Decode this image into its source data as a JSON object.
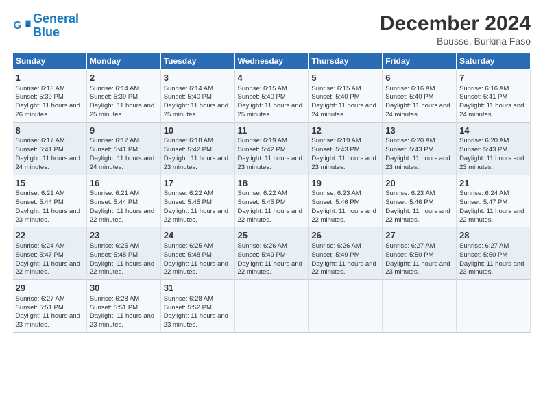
{
  "logo": {
    "line1": "General",
    "line2": "Blue"
  },
  "title": "December 2024",
  "subtitle": "Bousse, Burkina Faso",
  "days_of_week": [
    "Sunday",
    "Monday",
    "Tuesday",
    "Wednesday",
    "Thursday",
    "Friday",
    "Saturday"
  ],
  "weeks": [
    [
      {
        "day": "1",
        "sunrise": "6:13 AM",
        "sunset": "5:39 PM",
        "daylight": "11 hours and 26 minutes."
      },
      {
        "day": "2",
        "sunrise": "6:14 AM",
        "sunset": "5:39 PM",
        "daylight": "11 hours and 25 minutes."
      },
      {
        "day": "3",
        "sunrise": "6:14 AM",
        "sunset": "5:40 PM",
        "daylight": "11 hours and 25 minutes."
      },
      {
        "day": "4",
        "sunrise": "6:15 AM",
        "sunset": "5:40 PM",
        "daylight": "11 hours and 25 minutes."
      },
      {
        "day": "5",
        "sunrise": "6:15 AM",
        "sunset": "5:40 PM",
        "daylight": "11 hours and 24 minutes."
      },
      {
        "day": "6",
        "sunrise": "6:16 AM",
        "sunset": "5:40 PM",
        "daylight": "11 hours and 24 minutes."
      },
      {
        "day": "7",
        "sunrise": "6:16 AM",
        "sunset": "5:41 PM",
        "daylight": "11 hours and 24 minutes."
      }
    ],
    [
      {
        "day": "8",
        "sunrise": "6:17 AM",
        "sunset": "5:41 PM",
        "daylight": "11 hours and 24 minutes."
      },
      {
        "day": "9",
        "sunrise": "6:17 AM",
        "sunset": "5:41 PM",
        "daylight": "11 hours and 24 minutes."
      },
      {
        "day": "10",
        "sunrise": "6:18 AM",
        "sunset": "5:42 PM",
        "daylight": "11 hours and 23 minutes."
      },
      {
        "day": "11",
        "sunrise": "6:19 AM",
        "sunset": "5:42 PM",
        "daylight": "11 hours and 23 minutes."
      },
      {
        "day": "12",
        "sunrise": "6:19 AM",
        "sunset": "5:43 PM",
        "daylight": "11 hours and 23 minutes."
      },
      {
        "day": "13",
        "sunrise": "6:20 AM",
        "sunset": "5:43 PM",
        "daylight": "11 hours and 23 minutes."
      },
      {
        "day": "14",
        "sunrise": "6:20 AM",
        "sunset": "5:43 PM",
        "daylight": "11 hours and 23 minutes."
      }
    ],
    [
      {
        "day": "15",
        "sunrise": "6:21 AM",
        "sunset": "5:44 PM",
        "daylight": "11 hours and 23 minutes."
      },
      {
        "day": "16",
        "sunrise": "6:21 AM",
        "sunset": "5:44 PM",
        "daylight": "11 hours and 22 minutes."
      },
      {
        "day": "17",
        "sunrise": "6:22 AM",
        "sunset": "5:45 PM",
        "daylight": "11 hours and 22 minutes."
      },
      {
        "day": "18",
        "sunrise": "6:22 AM",
        "sunset": "5:45 PM",
        "daylight": "11 hours and 22 minutes."
      },
      {
        "day": "19",
        "sunrise": "6:23 AM",
        "sunset": "5:46 PM",
        "daylight": "11 hours and 22 minutes."
      },
      {
        "day": "20",
        "sunrise": "6:23 AM",
        "sunset": "5:46 PM",
        "daylight": "11 hours and 22 minutes."
      },
      {
        "day": "21",
        "sunrise": "6:24 AM",
        "sunset": "5:47 PM",
        "daylight": "11 hours and 22 minutes."
      }
    ],
    [
      {
        "day": "22",
        "sunrise": "6:24 AM",
        "sunset": "5:47 PM",
        "daylight": "11 hours and 22 minutes."
      },
      {
        "day": "23",
        "sunrise": "6:25 AM",
        "sunset": "5:48 PM",
        "daylight": "11 hours and 22 minutes."
      },
      {
        "day": "24",
        "sunrise": "6:25 AM",
        "sunset": "5:48 PM",
        "daylight": "11 hours and 22 minutes."
      },
      {
        "day": "25",
        "sunrise": "6:26 AM",
        "sunset": "5:49 PM",
        "daylight": "11 hours and 22 minutes."
      },
      {
        "day": "26",
        "sunrise": "6:26 AM",
        "sunset": "5:49 PM",
        "daylight": "11 hours and 22 minutes."
      },
      {
        "day": "27",
        "sunrise": "6:27 AM",
        "sunset": "5:50 PM",
        "daylight": "11 hours and 23 minutes."
      },
      {
        "day": "28",
        "sunrise": "6:27 AM",
        "sunset": "5:50 PM",
        "daylight": "11 hours and 23 minutes."
      }
    ],
    [
      {
        "day": "29",
        "sunrise": "6:27 AM",
        "sunset": "5:51 PM",
        "daylight": "11 hours and 23 minutes."
      },
      {
        "day": "30",
        "sunrise": "6:28 AM",
        "sunset": "5:51 PM",
        "daylight": "11 hours and 23 minutes."
      },
      {
        "day": "31",
        "sunrise": "6:28 AM",
        "sunset": "5:52 PM",
        "daylight": "11 hours and 23 minutes."
      },
      null,
      null,
      null,
      null
    ]
  ]
}
